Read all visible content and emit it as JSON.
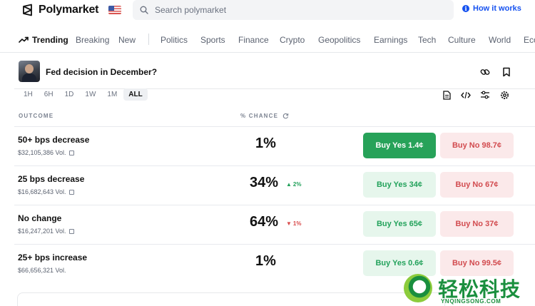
{
  "header": {
    "brand": "Polymarket",
    "search_placeholder": "Search polymarket",
    "how_it_works": "How it works"
  },
  "nav": {
    "trending": "Trending",
    "items": [
      "Breaking",
      "New",
      "Politics",
      "Sports",
      "Finance",
      "Crypto",
      "Geopolitics",
      "Earnings",
      "Tech",
      "Culture",
      "World",
      "Eco"
    ]
  },
  "market": {
    "title": "Fed decision in December?",
    "ranges": [
      "1H",
      "6H",
      "1D",
      "1W",
      "1M",
      "ALL"
    ],
    "active_range": "ALL",
    "outcome_header": "OUTCOME",
    "chance_header": "% CHANCE",
    "outcomes": [
      {
        "name": "50+ bps decrease",
        "volume": "$32,105,386 Vol.",
        "chance": "1%",
        "delta": "",
        "yes": "Buy Yes 1.4¢",
        "no": "Buy No 98.7¢"
      },
      {
        "name": "25 bps decrease",
        "volume": "$16,682,643 Vol.",
        "chance": "34%",
        "delta": "2%",
        "yes": "Buy Yes 34¢",
        "no": "Buy No 67¢"
      },
      {
        "name": "No change",
        "volume": "$16,247,201 Vol.",
        "chance": "64%",
        "delta": "1%",
        "yes": "Buy Yes 65¢",
        "no": "Buy No 37¢"
      },
      {
        "name": "25+ bps increase",
        "volume": "$66,656,321 Vol.",
        "chance": "1%",
        "delta": "",
        "yes": "Buy Yes 0.6¢",
        "no": "Buy No 99.5¢"
      }
    ]
  },
  "watermark": {
    "text": "轻松科技",
    "sub": "YNQINGSONG.COM"
  },
  "colors": {
    "accent_blue": "#1652f0",
    "yes_green": "#27a259",
    "no_red": "#d24b4f"
  }
}
